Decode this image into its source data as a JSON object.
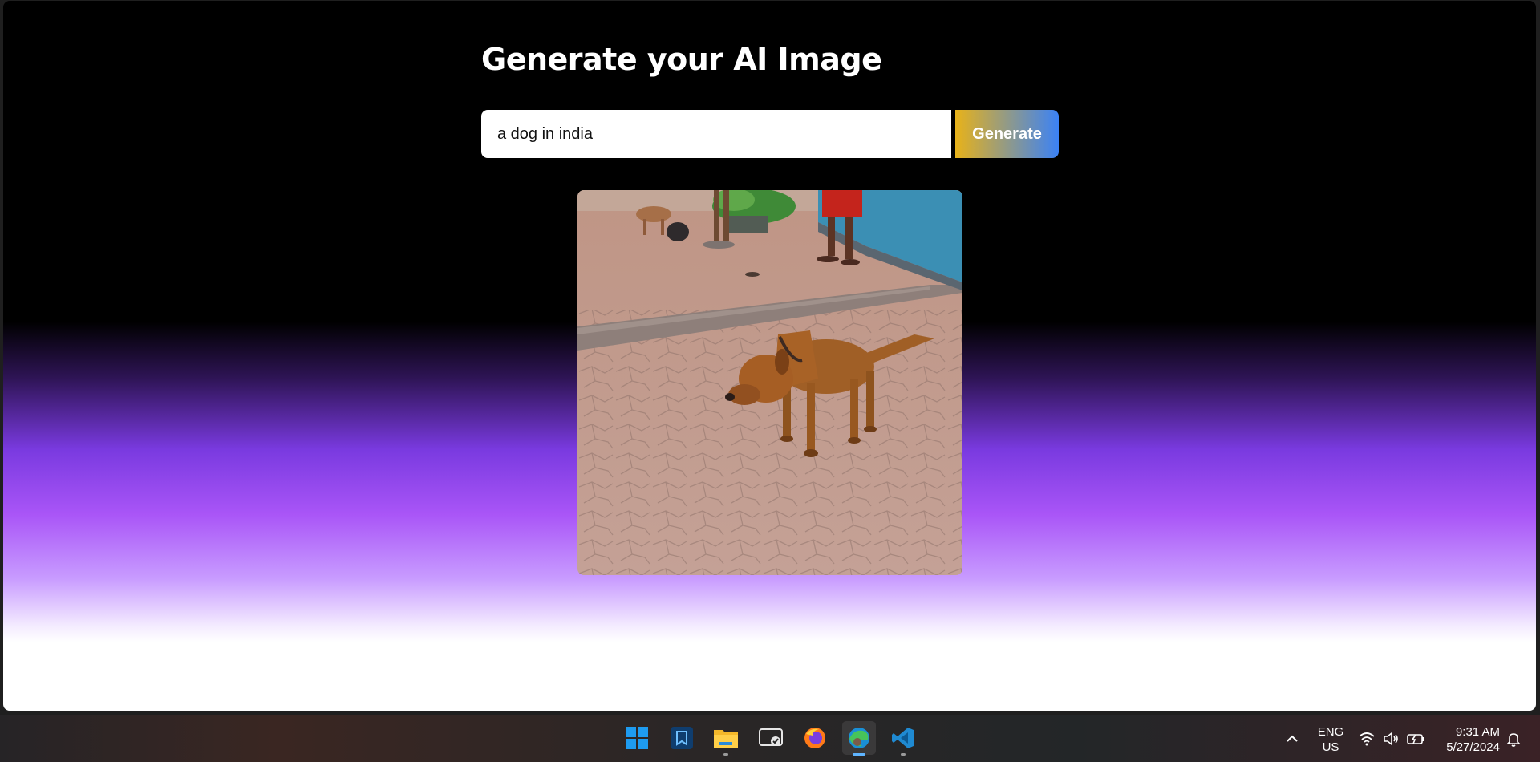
{
  "page": {
    "title": "Generate your AI Image"
  },
  "search": {
    "value": "a dog in india",
    "placeholder": ""
  },
  "actions": {
    "generate_label": "Generate"
  },
  "result": {
    "alt": "generated image"
  },
  "colors": {
    "generate_gradient_start": "#e8b219",
    "generate_gradient_end": "#3b82f6",
    "accent_purple": "#a955f7"
  },
  "taskbar": {
    "apps": [
      {
        "name": "windows-start-icon",
        "running": false,
        "active": false
      },
      {
        "name": "sandbox-app-icon",
        "running": false,
        "active": false
      },
      {
        "name": "file-explorer-icon",
        "running": true,
        "active": false
      },
      {
        "name": "remote-desktop-icon",
        "running": false,
        "active": false
      },
      {
        "name": "firefox-icon",
        "running": false,
        "active": false
      },
      {
        "name": "edge-browser-icon",
        "running": true,
        "active": true
      },
      {
        "name": "vscode-icon",
        "running": true,
        "active": false
      }
    ],
    "language_primary": "ENG",
    "language_secondary": "US",
    "time": "9:31 AM",
    "date": "5/27/2024"
  }
}
